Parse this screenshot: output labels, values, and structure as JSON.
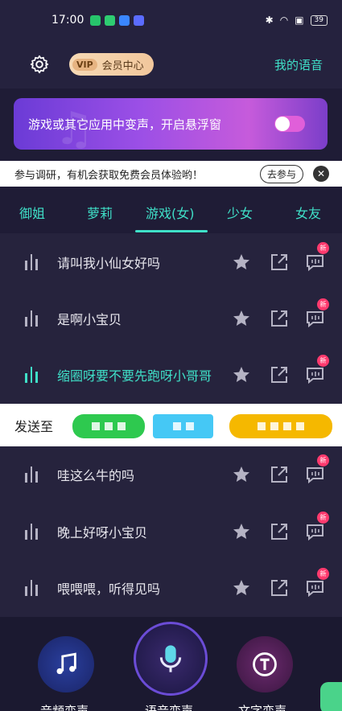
{
  "status_bar": {
    "time": "17:00",
    "battery": "39"
  },
  "header": {
    "vip_tag": "VIP",
    "member_center": "会员中心",
    "my_voice": "我的语音"
  },
  "banner": {
    "text": "游戏或其它应用中变声，开启悬浮窗",
    "toggle_state": "off"
  },
  "survey": {
    "text": "参与调研，有机会获取免费会员体验哟！",
    "join_label": "去参与",
    "close_symbol": "✕"
  },
  "tabs": [
    {
      "label": "御姐"
    },
    {
      "label": "萝莉"
    },
    {
      "label": "游戏(女)",
      "selected": true
    },
    {
      "label": "少女"
    },
    {
      "label": "女友"
    }
  ],
  "voice_list_top": [
    {
      "label": "请叫我小仙女好吗",
      "badge": "新"
    },
    {
      "label": "是啊小宝贝",
      "badge": "新"
    },
    {
      "label": "缩圈呀要不要先跑呀小哥哥",
      "badge": "新",
      "active": true
    }
  ],
  "send_to": {
    "label": "发送至"
  },
  "voice_list_bottom": [
    {
      "label": "哇这么牛的吗",
      "badge": "新"
    },
    {
      "label": "晚上好呀小宝贝",
      "badge": "新"
    },
    {
      "label": "喂喂喂，听得见吗",
      "badge": "新"
    }
  ],
  "bottom_nav": [
    {
      "label": "音频变声"
    },
    {
      "label": "语音变声",
      "selected": true
    },
    {
      "label": "文字变声"
    }
  ],
  "colors": {
    "accent": "#3fe0c8",
    "badge": "#ff3a6e",
    "background": "#1f1c36"
  }
}
